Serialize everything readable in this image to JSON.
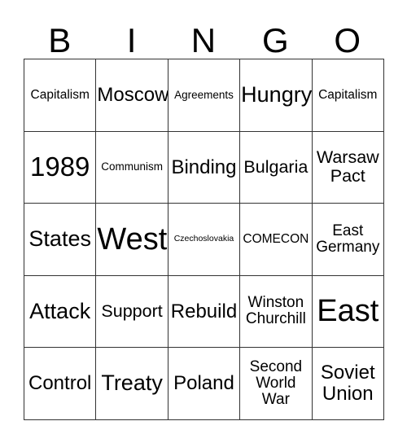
{
  "card": {
    "title_letters": [
      "B",
      "I",
      "N",
      "G",
      "O"
    ],
    "columns": 5,
    "rows": 5,
    "border_color": "#333333",
    "text_color": "#000000",
    "background_color": "#ffffff",
    "cells": [
      [
        {
          "text": "Capitalism",
          "size": "fs-s"
        },
        {
          "text": "Moscow",
          "size": "fs-l"
        },
        {
          "text": "Agreements",
          "size": "fs-xs"
        },
        {
          "text": "Hungry",
          "size": "fs-xl"
        },
        {
          "text": "Capitalism",
          "size": "fs-s"
        }
      ],
      [
        {
          "text": "1989",
          "size": "fs-xxl"
        },
        {
          "text": "Communism",
          "size": "fs-xs"
        },
        {
          "text": "Binding",
          "size": "fs-l"
        },
        {
          "text": "Bulgaria",
          "size": "fs-ml"
        },
        {
          "text": "Warsaw\nPact",
          "size": "fs-ml"
        }
      ],
      [
        {
          "text": "States",
          "size": "fs-xl"
        },
        {
          "text": "West",
          "size": "fs-xxxl"
        },
        {
          "text": "Czechoslovakia",
          "size": "fs-xxs"
        },
        {
          "text": "COMECON",
          "size": "fs-s"
        },
        {
          "text": "East\nGermany",
          "size": "fs-m"
        }
      ],
      [
        {
          "text": "Attack",
          "size": "fs-xl"
        },
        {
          "text": "Support",
          "size": "fs-ml"
        },
        {
          "text": "Rebuild",
          "size": "fs-l"
        },
        {
          "text": "Winston\nChurchill",
          "size": "fs-m"
        },
        {
          "text": "East",
          "size": "fs-xxxl"
        }
      ],
      [
        {
          "text": "Control",
          "size": "fs-l"
        },
        {
          "text": "Treaty",
          "size": "fs-xl"
        },
        {
          "text": "Poland",
          "size": "fs-l"
        },
        {
          "text": "Second\nWorld\nWar",
          "size": "fs-m"
        },
        {
          "text": "Soviet\nUnion",
          "size": "fs-l"
        }
      ]
    ]
  }
}
